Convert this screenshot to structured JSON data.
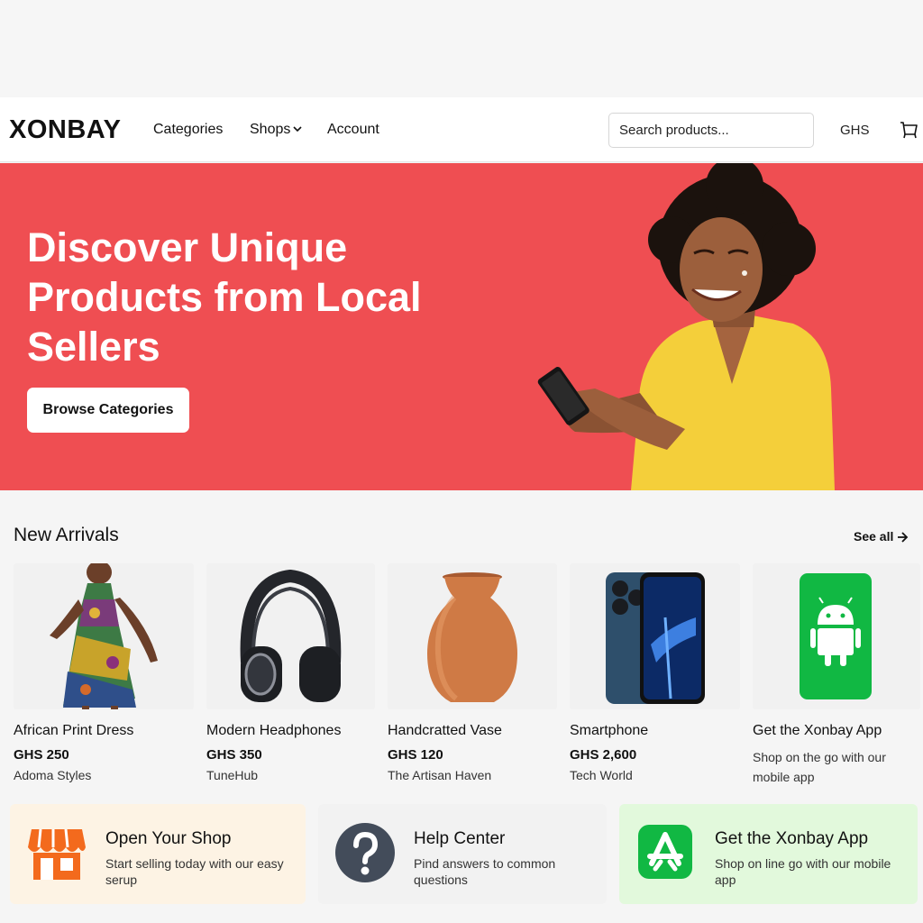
{
  "header": {
    "logo": "XONBAY",
    "nav": {
      "categories": "Categories",
      "shops": "Shops",
      "account": "Account"
    },
    "search_placeholder": "Search products...",
    "currency": "GHS"
  },
  "hero": {
    "title": "Discover Unique Products from Local Sellers",
    "button_label": "Browse Categories",
    "background_color": "#ef4e52"
  },
  "new_arrivals": {
    "title": "New Arrivals",
    "see_all": "See all",
    "items": [
      {
        "name": "African Print Dress",
        "price": "GHS 250",
        "shop": "Adoma Styles",
        "image": "dress-image"
      },
      {
        "name": "Modern Headphones",
        "price": "GHS 350",
        "shop": "TuneHub",
        "image": "headphones-image"
      },
      {
        "name": "Handcratted Vase",
        "price": "GHS 120",
        "shop": "The Artisan Haven",
        "image": "vase-image"
      },
      {
        "name": "Smartphone",
        "price": "GHS 2,600",
        "shop": "Tech World",
        "image": "smartphone-image"
      }
    ],
    "app_card": {
      "title": "Get the Xonbay App",
      "description": "Shop on the go with our mobile app",
      "icon": "android-icon"
    }
  },
  "promos": [
    {
      "title": "Open Your Shop",
      "description": "Start selling today with our easy serup",
      "icon": "storefront-icon",
      "background": "#fdf3e4"
    },
    {
      "title": "Help Center",
      "description": "Pind answers to common questions",
      "icon": "question-icon",
      "background": "#f2f2f2"
    },
    {
      "title": "Get the Xonbay App",
      "description": "Shop on line go with our mobile app",
      "icon": "app-store-icon",
      "background": "#e2f9dc"
    }
  ]
}
